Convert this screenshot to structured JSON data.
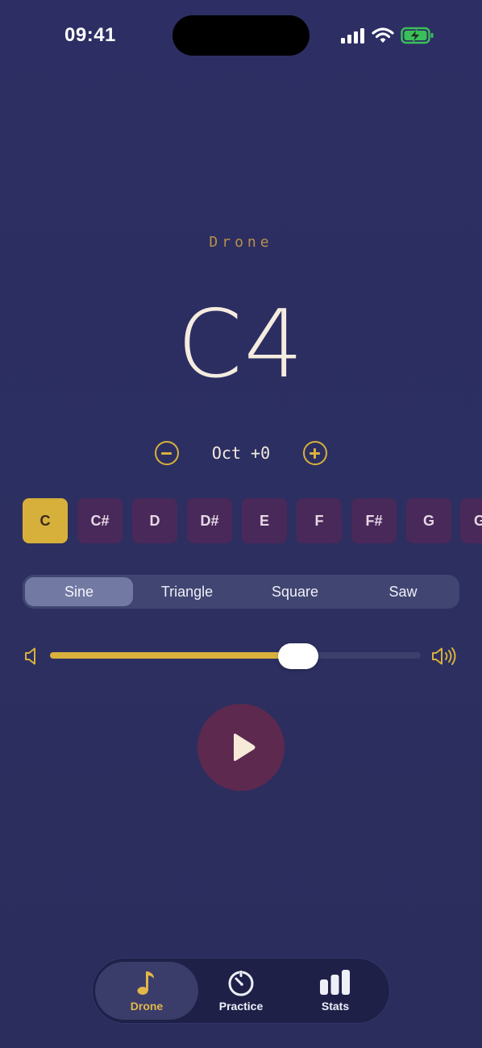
{
  "status_bar": {
    "time": "09:41"
  },
  "header": {
    "mode_title": "Drone",
    "current_note": "C4"
  },
  "octave": {
    "label": "Oct +0",
    "decrement_icon": "minus-circle-icon",
    "increment_icon": "plus-circle-icon"
  },
  "notes": {
    "items": [
      "C",
      "C#",
      "D",
      "D#",
      "E",
      "F",
      "F#",
      "G",
      "G#"
    ],
    "selected": "C"
  },
  "waveform": {
    "options": [
      "Sine",
      "Triangle",
      "Square",
      "Saw"
    ],
    "selected": "Sine"
  },
  "volume": {
    "level_fraction": 0.67,
    "low_icon": "speaker-low-icon",
    "high_icon": "speaker-high-icon"
  },
  "play": {
    "icon": "play-icon"
  },
  "tabbar": {
    "tabs": [
      {
        "label": "Drone",
        "icon": "music-note-icon"
      },
      {
        "label": "Practice",
        "icon": "timer-icon"
      },
      {
        "label": "Stats",
        "icon": "bar-chart-icon"
      }
    ],
    "selected": "Drone"
  },
  "colors": {
    "background": "#2d2e63",
    "accent": "#d8b13d",
    "key_bg": "#49295a",
    "play_bg": "#5d294f",
    "text": "#f5ece0"
  }
}
